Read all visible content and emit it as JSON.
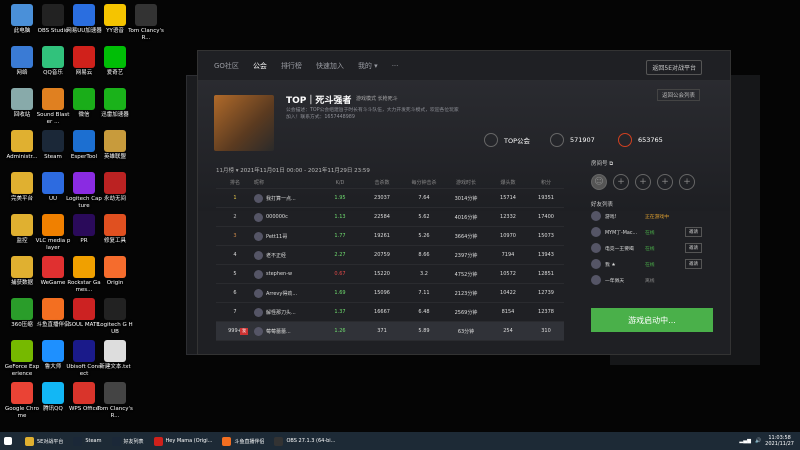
{
  "desktop": {
    "icons": [
      {
        "label": "此电脑",
        "color": "#4a90d9",
        "col": 0,
        "row": 0
      },
      {
        "label": "OBS Studio",
        "color": "#222",
        "col": 1,
        "row": 0
      },
      {
        "label": "网易UU加速器",
        "color": "#2a6ee0",
        "col": 2,
        "row": 0
      },
      {
        "label": "YY语音",
        "color": "#f5c400",
        "col": 3,
        "row": 0
      },
      {
        "label": "Tom Clancy's R...",
        "color": "#333",
        "col": 4,
        "row": 0
      },
      {
        "label": "网络",
        "color": "#3a7bd5",
        "col": 0,
        "row": 1
      },
      {
        "label": "QQ音乐",
        "color": "#31c27c",
        "col": 1,
        "row": 1
      },
      {
        "label": "网易云",
        "color": "#d0211b",
        "col": 2,
        "row": 1
      },
      {
        "label": "爱奇艺",
        "color": "#00be06",
        "col": 3,
        "row": 1
      },
      {
        "label": "回收站",
        "color": "#8aa",
        "col": 0,
        "row": 2
      },
      {
        "label": "Sound Blaster ...",
        "color": "#e08020",
        "col": 1,
        "row": 2
      },
      {
        "label": "微信",
        "color": "#1aad19",
        "col": 2,
        "row": 2
      },
      {
        "label": "迅雷加速器",
        "color": "#1ab21a",
        "col": 3,
        "row": 2
      },
      {
        "label": "Administr...",
        "color": "#e0b030",
        "col": 0,
        "row": 3
      },
      {
        "label": "Steam",
        "color": "#1b2838",
        "col": 1,
        "row": 3
      },
      {
        "label": "EsperTool",
        "color": "#1c6fd1",
        "col": 2,
        "row": 3
      },
      {
        "label": "英雄联盟",
        "color": "#c89b3c",
        "col": 3,
        "row": 3
      },
      {
        "label": "完美平台",
        "color": "#e0b030",
        "col": 0,
        "row": 4
      },
      {
        "label": "UU",
        "color": "#2d6be0",
        "col": 1,
        "row": 4
      },
      {
        "label": "Logitech Capture",
        "color": "#8a2be2",
        "col": 2,
        "row": 4
      },
      {
        "label": "永劫无间",
        "color": "#b22",
        "col": 3,
        "row": 4
      },
      {
        "label": "监控",
        "color": "#e0b030",
        "col": 0,
        "row": 5
      },
      {
        "label": "VLC media player",
        "color": "#f08000",
        "col": 1,
        "row": 5
      },
      {
        "label": "PR",
        "color": "#2a0a5a",
        "col": 2,
        "row": 5
      },
      {
        "label": "修复工具",
        "color": "#e05020",
        "col": 3,
        "row": 5
      },
      {
        "label": "捕获数据",
        "color": "#e0b030",
        "col": 0,
        "row": 6
      },
      {
        "label": "WeGame",
        "color": "#e03030",
        "col": 1,
        "row": 6
      },
      {
        "label": "Rockstar Games...",
        "color": "#f0a000",
        "col": 2,
        "row": 6
      },
      {
        "label": "Origin",
        "color": "#f56c2d",
        "col": 3,
        "row": 6
      },
      {
        "label": "360压缩",
        "color": "#2a9d2a",
        "col": 0,
        "row": 7
      },
      {
        "label": "斗鱼直播伴侣",
        "color": "#f36f21",
        "col": 1,
        "row": 7
      },
      {
        "label": "SOUL MATE",
        "color": "#c22",
        "col": 2,
        "row": 7
      },
      {
        "label": "Logitech G HUB",
        "color": "#222",
        "col": 3,
        "row": 7
      },
      {
        "label": "GeForce Experience",
        "color": "#76b900",
        "col": 0,
        "row": 8
      },
      {
        "label": "鲁大师",
        "color": "#1e90ff",
        "col": 1,
        "row": 8
      },
      {
        "label": "Ubisoft Connect",
        "color": "#1a1a8a",
        "col": 2,
        "row": 8
      },
      {
        "label": "新建文本.txt",
        "color": "#ddd",
        "col": 3,
        "row": 8
      },
      {
        "label": "Google Chrome",
        "color": "#ea4335",
        "col": 0,
        "row": 9
      },
      {
        "label": "腾讯QQ",
        "color": "#12b7f5",
        "col": 1,
        "row": 9
      },
      {
        "label": "WPS Office",
        "color": "#d9342b",
        "col": 2,
        "row": 9
      },
      {
        "label": "Tom Clancy's R...",
        "color": "#444",
        "col": 3,
        "row": 9
      }
    ]
  },
  "window": {
    "nav": [
      "GO社区",
      "公会",
      "排行榜",
      "快速加入",
      "我的 ▾",
      "···"
    ],
    "active_nav": 1,
    "back_button": "返回5E对战平台",
    "open_list_button": "返回公会列表",
    "team": {
      "title": "TOP｜死斗强者",
      "subtitle": "游戏模式  长枪死斗",
      "description": "公会描述：TOP公会组建旨于时长有斗斗队伍，大力开发死斗模式，欢迎各位玩家加入！联系方式：1657448989"
    },
    "stats": [
      {
        "label": "TOP公会",
        "icon": "guild-icon"
      },
      {
        "label": "571907",
        "icon": "members-icon"
      },
      {
        "label": "653765",
        "icon": "points-icon"
      }
    ],
    "table_meta": {
      "period_label": "11月榜",
      "period_range": "2021年11月01日 00:00 - 2021年11月29日 23:59"
    },
    "table": {
      "headers": [
        "排名",
        "昵称",
        "K/D",
        "击杀数",
        "每分钟击杀",
        "游戏时长",
        "爆头数",
        "积分"
      ],
      "rows": [
        {
          "rank": "1",
          "name": "我打算一点...",
          "kd": "1.95",
          "kills": "23037",
          "avg": "7.64",
          "time": "3014分钟",
          "head": "15714",
          "pts": "19351",
          "rank_color": "#e8c94a",
          "kd_color": "#6fdc6f"
        },
        {
          "rank": "2",
          "name": "000000c",
          "kd": "1.13",
          "kills": "22584",
          "avg": "5.62",
          "time": "4016分钟",
          "head": "12332",
          "pts": "17400",
          "rank_color": "#c0c0c0",
          "kd_color": "#6fdc6f"
        },
        {
          "rank": "3",
          "name": "Pett11哥",
          "kd": "1.77",
          "kills": "19261",
          "avg": "5.26",
          "time": "3664分钟",
          "head": "10970",
          "pts": "15073",
          "rank_color": "#cd8a4a",
          "kd_color": "#6fdc6f"
        },
        {
          "rank": "4",
          "name": "老不正经",
          "kd": "2.27",
          "kills": "20759",
          "avg": "8.66",
          "time": "2397分钟",
          "head": "7194",
          "pts": "13943",
          "rank_color": "#ddd",
          "kd_color": "#6fdc6f"
        },
        {
          "rank": "5",
          "name": "stephen-w",
          "kd": "0.67",
          "kills": "15220",
          "avg": "3.2",
          "time": "4752分钟",
          "head": "10572",
          "pts": "12851",
          "rank_color": "#ddd",
          "kd_color": "#e04848"
        },
        {
          "rank": "6",
          "name": "Arrevy得劲...",
          "kd": "1.69",
          "kills": "15096",
          "avg": "7.11",
          "time": "2123分钟",
          "head": "10422",
          "pts": "12739",
          "rank_color": "#ddd",
          "kd_color": "#6fdc6f"
        },
        {
          "rank": "7",
          "name": "解怪那刀头...",
          "kd": "1.37",
          "kills": "16667",
          "avg": "6.48",
          "time": "2569分钟",
          "head": "8154",
          "pts": "12378",
          "rank_color": "#ddd",
          "kd_color": "#6fdc6f"
        }
      ],
      "my_row": {
        "rank": "999+",
        "badge": "我",
        "name": "莓莓蕾蕾...",
        "kd": "1.26",
        "kills": "371",
        "avg": "5.89",
        "time": "63分钟",
        "head": "254",
        "pts": "310",
        "kd_color": "#6fdc6f"
      }
    },
    "side": {
      "room_label": "房间号",
      "friends_title": "好友列表",
      "friends": [
        {
          "name": "游戏!",
          "status": "正在游戏中",
          "status_color": "#e0a030",
          "invite": ""
        },
        {
          "name": "MYM丁-Mac...",
          "status": "在线",
          "status_color": "#4ab04a",
          "invite": "邀请"
        },
        {
          "name": "电竞一王要喝",
          "status": "在线",
          "status_color": "#4ab04a",
          "invite": "邀请"
        },
        {
          "name": "我 ★",
          "status": "在线",
          "status_color": "#4ab04a",
          "invite": "邀请"
        },
        {
          "name": "一年佩天",
          "status": "离线",
          "status_color": "#888",
          "invite": ""
        }
      ],
      "start_button": "游戏启动中..."
    }
  },
  "taskbar": {
    "items": [
      {
        "label": "5E对战平台",
        "color": "#e0b030",
        "active": false
      },
      {
        "label": "Steam",
        "color": "#1b2838",
        "active": false
      },
      {
        "label": "好友列表",
        "color": "#1b2838",
        "active": false
      },
      {
        "label": "Hey Mama (Origi...",
        "color": "#d0211b",
        "active": false
      },
      {
        "label": "斗鱼直播伴侣",
        "color": "#f36f21",
        "active": false
      },
      {
        "label": "OBS 27.1.3 (64-bi...",
        "color": "#333",
        "active": false
      }
    ],
    "time": "11:03:58",
    "date": "2021/11/27"
  }
}
